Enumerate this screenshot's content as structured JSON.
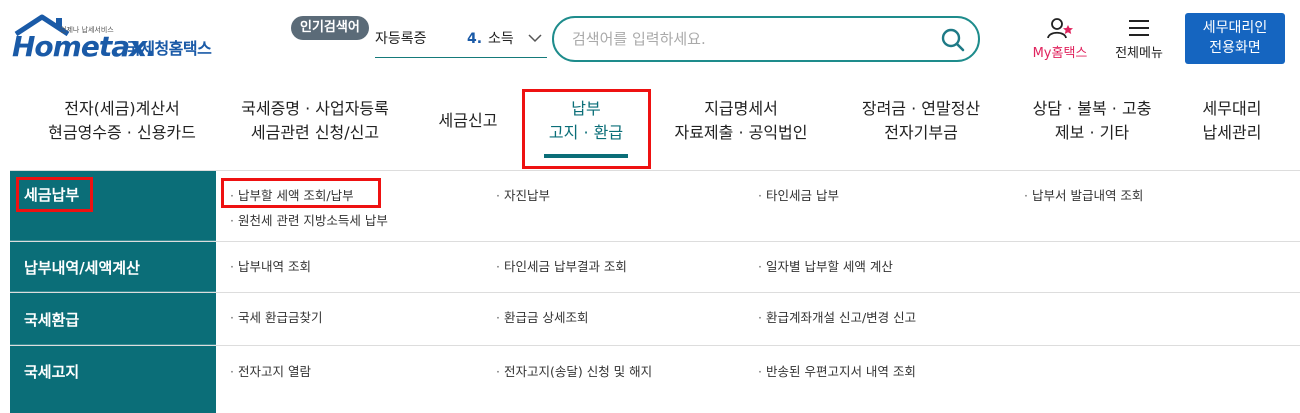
{
  "header": {
    "logo_slogan": "언제나 납세서비스",
    "logo_brand": "Hometax.",
    "logo_brand_kr": "국세청홈택스",
    "popular_label": "인기검색어",
    "popular_prev": "자등록증",
    "popular_rank": "4.",
    "popular_term": "소득",
    "search_placeholder": "검색어를 입력하세요.",
    "my_hometax": "My홈택스",
    "all_menu": "전체메뉴",
    "agent_line1": "세무대리인",
    "agent_line2": "전용화면"
  },
  "nav": [
    {
      "l1": "전자(세금)계산서",
      "l2": "현금영수증 · 신용카드"
    },
    {
      "l1": "국세증명 · 사업자등록",
      "l2": "세금관련 신청/신고"
    },
    {
      "l1": "세금신고",
      "l2": ""
    },
    {
      "l1": "납부",
      "l2": "고지 · 환급"
    },
    {
      "l1": "지급명세서",
      "l2": "자료제출 · 공익법인"
    },
    {
      "l1": "장려금 · 연말정산",
      "l2": "전자기부금"
    },
    {
      "l1": "상담 · 불복 · 고충",
      "l2": "제보 · 기타"
    },
    {
      "l1": "세무대리",
      "l2": "납세관리"
    }
  ],
  "submenu": [
    {
      "category": "세금납부",
      "links": [
        "납부할 세액 조회/납부",
        "자진납부",
        "타인세금 납부",
        "납부서 발급내역 조회",
        "원천세 관련 지방소득세 납부"
      ]
    },
    {
      "category": "납부내역/세액계산",
      "links": [
        "납부내역 조회",
        "타인세금 납부결과 조회",
        "일자별 납부할 세액 계산"
      ]
    },
    {
      "category": "국세환급",
      "links": [
        "국세 환급금찾기",
        "환급금 상세조회",
        "환급계좌개설 신고/변경 신고"
      ]
    },
    {
      "category": "국세고지",
      "links": [
        "전자고지 열람",
        "전자고지(송달) 신청 및 해지",
        "반송된 우편고지서 내역 조회"
      ]
    }
  ],
  "colors": {
    "teal": "#0b6e78",
    "blue": "#1565c0",
    "highlight": "#e11111",
    "pink": "#e0245e"
  }
}
